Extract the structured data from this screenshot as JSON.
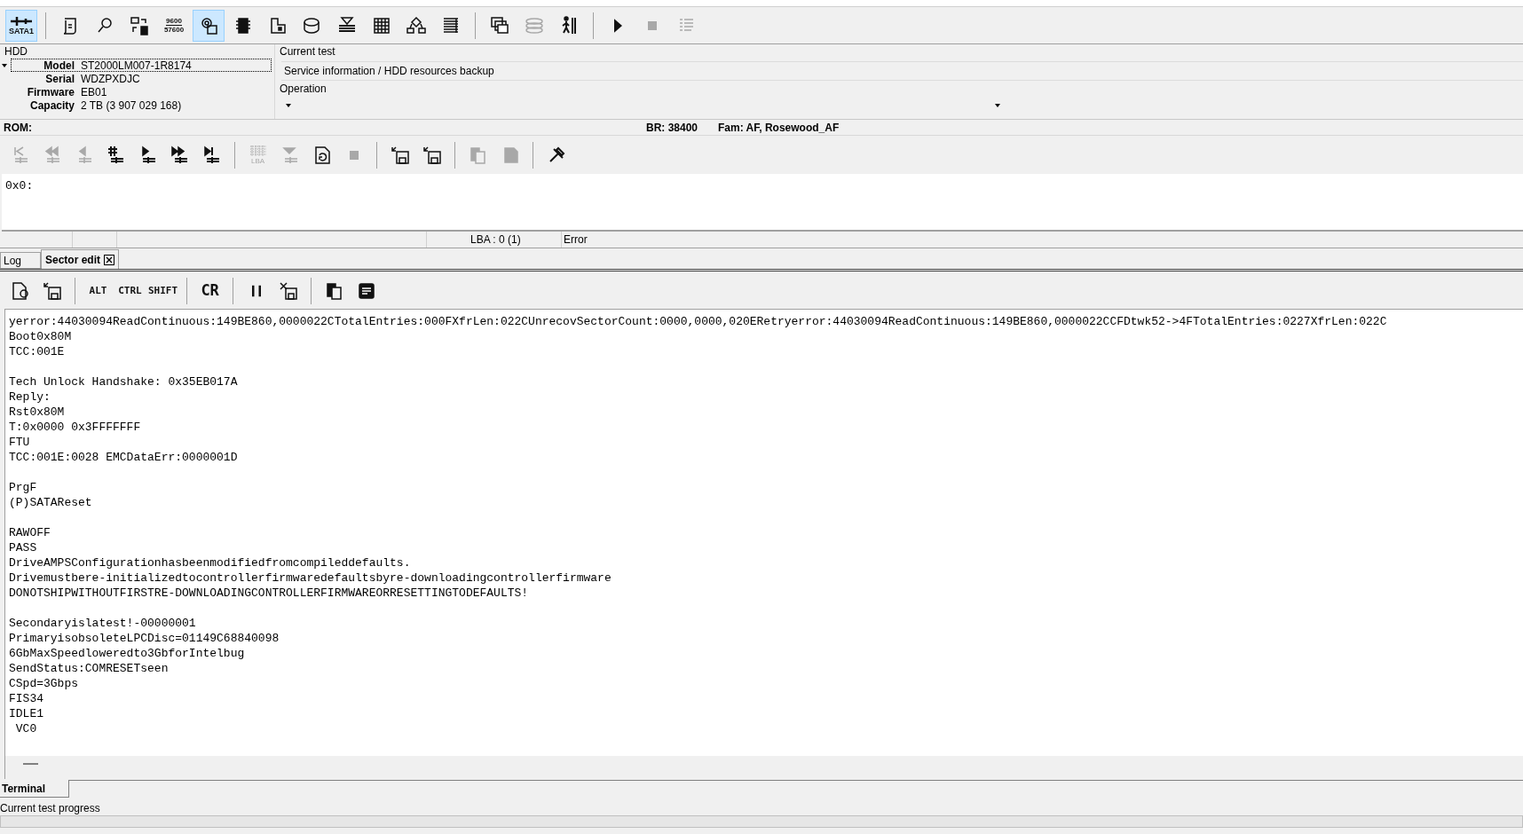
{
  "toolbar_main": [
    {
      "label": "SATA1",
      "selected": true,
      "disabled": false
    },
    {
      "selected": false,
      "disabled": false
    },
    {
      "selected": false,
      "disabled": false
    },
    {
      "selected": false,
      "disabled": false
    },
    {
      "labels": [
        "9600",
        "57600"
      ],
      "selected": false,
      "disabled": false
    },
    {
      "selected": true,
      "disabled": false
    },
    {
      "selected": false,
      "disabled": false
    },
    {
      "selected": false,
      "disabled": false
    },
    {
      "selected": false,
      "disabled": false
    },
    {
      "selected": false,
      "disabled": false
    },
    {
      "selected": false,
      "disabled": false
    },
    {
      "selected": false,
      "disabled": false
    },
    {
      "selected": false,
      "disabled": false
    },
    {
      "selected": false,
      "disabled": false
    },
    {
      "selected": false,
      "disabled": true
    },
    {
      "selected": false,
      "disabled": false
    },
    {
      "selected": false,
      "disabled": false
    },
    {
      "selected": false,
      "disabled": true
    },
    {
      "selected": false,
      "disabled": true
    }
  ],
  "hdd": {
    "title": "HDD",
    "fields": [
      {
        "label": "Model",
        "value": "ST2000LM007-1R8174",
        "selected": true
      },
      {
        "label": "Serial",
        "value": "WDZPXDJC",
        "selected": false
      },
      {
        "label": "Firmware",
        "value": "EB01",
        "selected": false
      },
      {
        "label": "Capacity",
        "value": "2 TB (3 907 029 168)",
        "selected": false
      }
    ]
  },
  "current_test": {
    "title": "Current test",
    "value": "Service information / HDD resources backup"
  },
  "operation": {
    "title": "Operation"
  },
  "rom_bar": {
    "label": "ROM:",
    "baud": "BR: 38400",
    "family": "Fam: AF, Rosewood_AF"
  },
  "toolbar_rom": [
    {
      "disabled": true
    },
    {
      "disabled": true
    },
    {
      "disabled": true
    },
    {
      "disabled": false
    },
    {
      "disabled": false
    },
    {
      "disabled": false
    },
    {
      "disabled": false
    },
    {
      "label": "LBA",
      "disabled": true
    },
    {
      "disabled": true
    },
    {
      "disabled": false
    },
    {
      "disabled": true
    },
    {
      "disabled": false
    },
    {
      "disabled": false
    },
    {
      "disabled": true
    },
    {
      "disabled": true
    },
    {
      "disabled": false
    }
  ],
  "hex_view": {
    "text": "0x0:"
  },
  "status_bar": {
    "lba": "LBA : 0 (1)",
    "state": "Error"
  },
  "tabs": [
    {
      "label": "Log",
      "selected": false,
      "closable": false
    },
    {
      "label": "Sector edit",
      "selected": true,
      "closable": true
    }
  ],
  "toolbar_terminal": [
    {
      "label": "ALT"
    },
    {
      "label": "CTRL"
    },
    {
      "label": "SHIFT"
    },
    {
      "label": "CR"
    }
  ],
  "terminal": {
    "blocks": [
      [
        "yerror:44030094ReadContinuous:149BE860,0000022CTotalEntries:000FXfrLen:022CUnrecovSectorCount:0000,0000,020ERetryerror:44030094ReadContinuous:149BE860,0000022CCFDtwk52->4FTotalEntries:0227XfrLen:022C",
        "Boot0x80M",
        "TCC:001E"
      ],
      [
        "Tech Unlock Handshake: 0x35EB017A",
        "Reply:",
        "Rst0x80M",
        "T:0x0000 0x3FFFFFFF",
        "FTU",
        "TCC:001E:0028 EMCDataErr:0000001D"
      ],
      [
        "PrgF",
        "(P)SATAReset"
      ],
      [
        "RAWOFF",
        "PASS",
        "DriveAMPSConfigurationhasbeenmodifiedfromcompileddefaults.",
        "Drivemustbere-initializedtocontrollerfirmwaredefaultsbyre-downloadingcontrollerfirmware",
        "DONOTSHIPWITHOUTFIRSTRE-DOWNLOADINGCONTROLLERFIRMWAREORRESETTINGTODEFAULTS!"
      ],
      [
        "Secondaryislatest!-00000001",
        "PrimaryisobsoleteLPCDisc=01149C68840098",
        "6GbMaxSpeedloweredto3GbforIntelbug",
        "SendStatus:COMRESETseen",
        "CSpd=3Gbps",
        "FIS34",
        "IDLE1",
        " VC0"
      ]
    ]
  },
  "bottom_tabs": [
    {
      "label": "Terminal",
      "selected": true
    }
  ],
  "progress": {
    "label": "Current test progress",
    "level": 0
  }
}
